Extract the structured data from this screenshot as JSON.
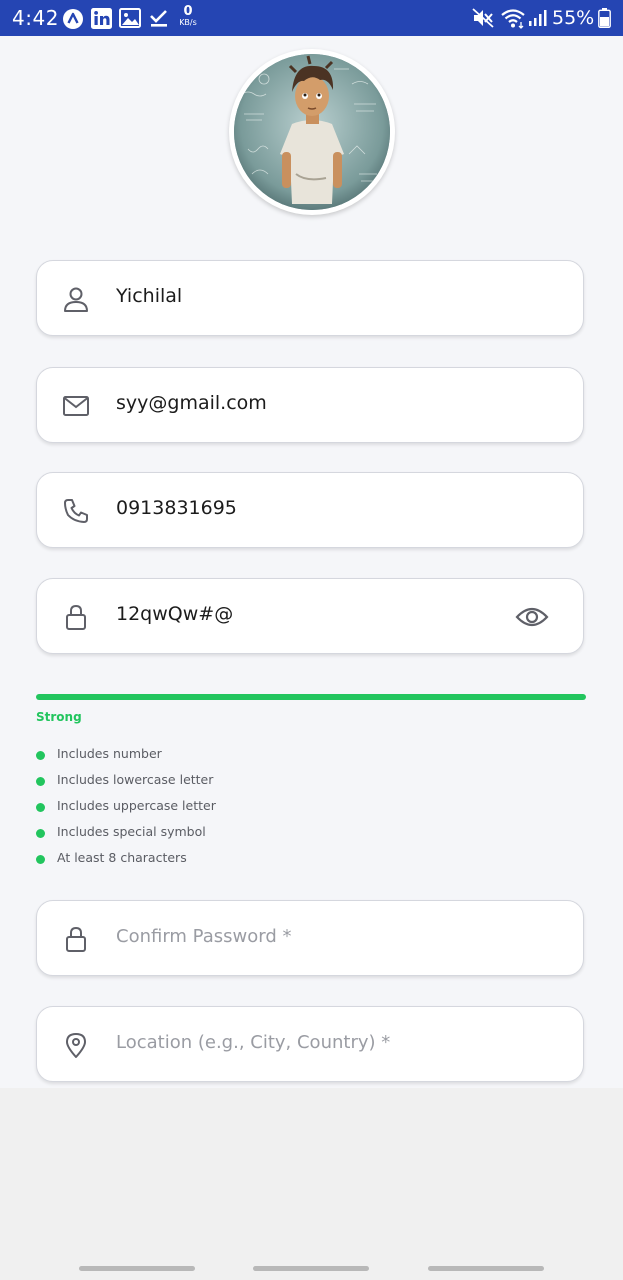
{
  "status_bar": {
    "time": "4:42",
    "net_speed_value": "0",
    "net_speed_unit": "KB/s",
    "battery_percent": "55%",
    "icons": [
      "app-icon",
      "linkedin-icon",
      "image-icon",
      "check-icon",
      "mute-icon",
      "wifi-icon",
      "signal-icon",
      "battery-icon"
    ]
  },
  "profile": {
    "avatar": "profile-avatar"
  },
  "form": {
    "name_value": "Yichilal",
    "email_value": "syy@gmail.com",
    "phone_value": "0913831695",
    "password_value": "12qwQw#@",
    "confirm_password_placeholder": "Confirm Password *",
    "location_placeholder": "Location (e.g., City, Country) *"
  },
  "password_strength": {
    "label": "Strong",
    "level": 1.0,
    "color": "#22c55e",
    "criteria": [
      "Includes number",
      "Includes lowercase letter",
      "Includes uppercase letter",
      "Includes special symbol",
      "At least 8 characters"
    ]
  },
  "colors": {
    "status_bar": "#2545b3",
    "accent_green": "#22c55e"
  }
}
